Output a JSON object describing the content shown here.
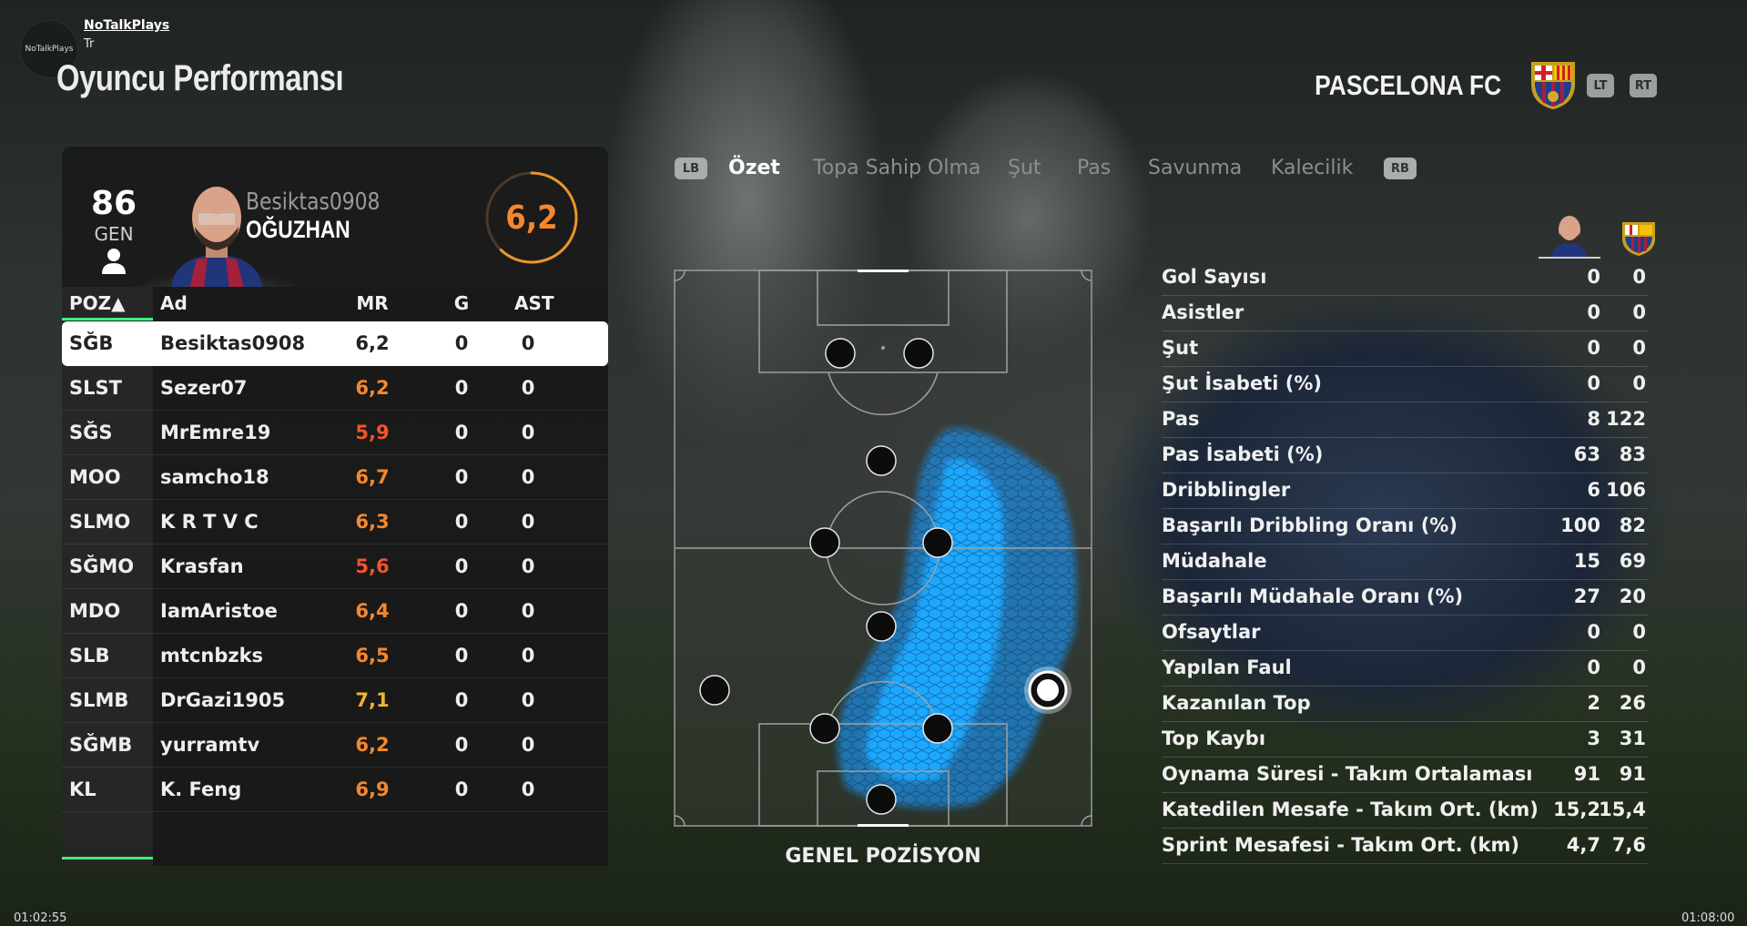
{
  "channel": {
    "name": "NoTalkPlays",
    "sub": "Tr",
    "logo_text": "NoTalkPlays"
  },
  "page_title": "Oyuncu Performansı",
  "club": {
    "name": "PASCELONA FC",
    "lt_label": "LT",
    "rt_label": "RT"
  },
  "player_card": {
    "overall": "86",
    "overall_label": "GEN",
    "gamertag": "Besiktas0908",
    "name": "OĞUZHAN",
    "rating": "6,2",
    "rating_fraction": 0.62
  },
  "table": {
    "headers": {
      "poz": "POZ▲",
      "ad": "Ad",
      "mr": "MR",
      "g": "G",
      "ast": "AST"
    },
    "rows": [
      {
        "pos": "SĞB",
        "name": "Besiktas0908",
        "mr": "6,2",
        "g": "0",
        "ast": "0",
        "mr_color": "#222222"
      },
      {
        "pos": "SLST",
        "name": "Sezer07",
        "mr": "6,2",
        "g": "0",
        "ast": "0",
        "mr_color": "#f5872c"
      },
      {
        "pos": "SĞS",
        "name": "MrEmre19",
        "mr": "5,9",
        "g": "0",
        "ast": "0",
        "mr_color": "#f0552f"
      },
      {
        "pos": "MOO",
        "name": "samcho18",
        "mr": "6,7",
        "g": "0",
        "ast": "0",
        "mr_color": "#f5872c"
      },
      {
        "pos": "SLMO",
        "name": "K R T V C",
        "mr": "6,3",
        "g": "0",
        "ast": "0",
        "mr_color": "#f5872c"
      },
      {
        "pos": "SĞMO",
        "name": "Krasfan",
        "mr": "5,6",
        "g": "0",
        "ast": "0",
        "mr_color": "#f0552f"
      },
      {
        "pos": "MDO",
        "name": "IamAristoe",
        "mr": "6,4",
        "g": "0",
        "ast": "0",
        "mr_color": "#f5872c"
      },
      {
        "pos": "SLB",
        "name": "mtcnbzks",
        "mr": "6,5",
        "g": "0",
        "ast": "0",
        "mr_color": "#f5872c"
      },
      {
        "pos": "SLMB",
        "name": "DrGazi1905",
        "mr": "7,1",
        "g": "0",
        "ast": "0",
        "mr_color": "#f0b52c"
      },
      {
        "pos": "SĞMB",
        "name": "yurramtv",
        "mr": "6,2",
        "g": "0",
        "ast": "0",
        "mr_color": "#f5872c"
      },
      {
        "pos": "KL",
        "name": "K. Feng",
        "mr": "6,9",
        "g": "0",
        "ast": "0",
        "mr_color": "#f5872c"
      }
    ]
  },
  "tabs": {
    "lb_label": "LB",
    "rb_label": "RB",
    "items": [
      {
        "label": "Özet",
        "active": true
      },
      {
        "label": "Topa Sahip Olma",
        "active": false
      },
      {
        "label": "Şut",
        "active": false
      },
      {
        "label": "Pas",
        "active": false
      },
      {
        "label": "Savunma",
        "active": false
      },
      {
        "label": "Kalecilik",
        "active": false
      }
    ]
  },
  "pitch": {
    "label": "GENEL POZİSYON"
  },
  "stats": [
    {
      "label": "Gol Sayısı",
      "player": "0",
      "team": "0"
    },
    {
      "label": "Asistler",
      "player": "0",
      "team": "0"
    },
    {
      "label": "Şut",
      "player": "0",
      "team": "0"
    },
    {
      "label": "Şut İsabeti (%)",
      "player": "0",
      "team": "0"
    },
    {
      "label": "Pas",
      "player": "8",
      "team": "122"
    },
    {
      "label": "Pas İsabeti (%)",
      "player": "63",
      "team": "83"
    },
    {
      "label": "Dribblingler",
      "player": "6",
      "team": "106"
    },
    {
      "label": "Başarılı Dribbling Oranı (%)",
      "player": "100",
      "team": "82"
    },
    {
      "label": "Müdahale",
      "player": "15",
      "team": "69"
    },
    {
      "label": "Başarılı Müdahale Oranı (%)",
      "player": "27",
      "team": "20"
    },
    {
      "label": "Ofsaytlar",
      "player": "0",
      "team": "0"
    },
    {
      "label": "Yapılan Faul",
      "player": "0",
      "team": "0"
    },
    {
      "label": "Kazanılan Top",
      "player": "2",
      "team": "26"
    },
    {
      "label": "Top Kaybı",
      "player": "3",
      "team": "31"
    },
    {
      "label": "Oynama Süresi - Takım Ortalaması",
      "player": "91",
      "team": "91"
    },
    {
      "label": "Katedilen Mesafe - Takım Ort. (km)",
      "player": "15,2",
      "team": "15,4"
    },
    {
      "label": "Sprint Mesafesi - Takım Ort. (km)",
      "player": "4,7",
      "team": "7,6"
    }
  ],
  "video": {
    "elapsed": "01:02:55",
    "duration": "01:08:00"
  },
  "colors": {
    "accent_green": "#3ef07c",
    "rating_orange": "#f5872c",
    "heat_blue": "#1aa3ff"
  }
}
